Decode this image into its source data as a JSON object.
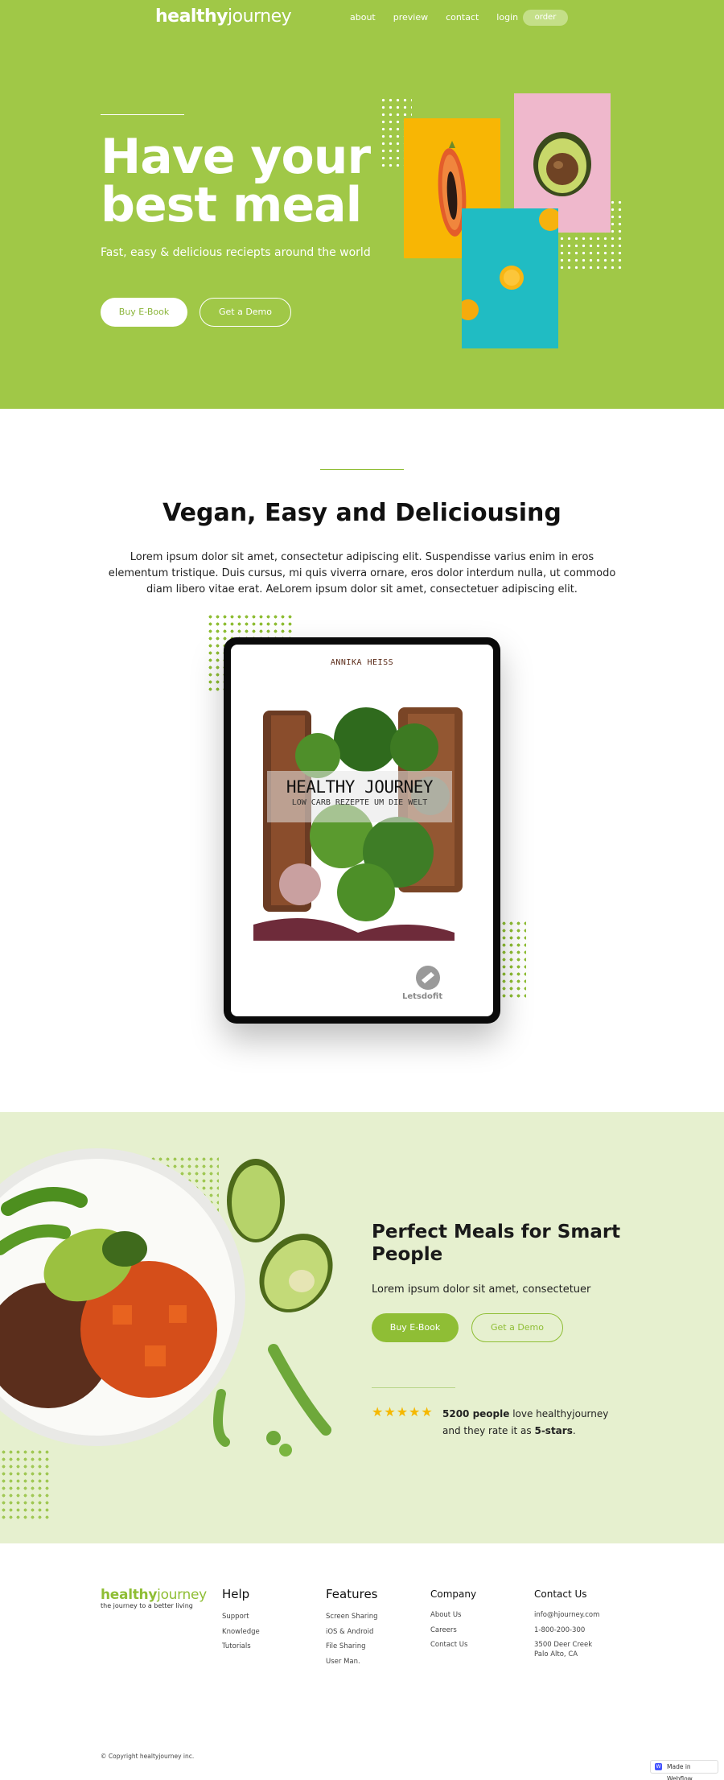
{
  "nav": {
    "logo_bold": "healthy",
    "logo_light": "journey",
    "links": [
      "about",
      "preview",
      "contact",
      "login"
    ],
    "order": "order"
  },
  "hero": {
    "title": "Have your best meal",
    "subtitle": "Fast, easy & delicious reciepts around the world",
    "btn_primary": "Buy E-Book",
    "btn_secondary": "Get a Demo"
  },
  "intro": {
    "title": "Vegan, Easy and Deliciousing",
    "body": "Lorem ipsum dolor sit amet, consectetur adipiscing elit. Suspendisse varius enim in eros elementum tristique. Duis cursus, mi quis viverra ornare, eros dolor interdum nulla, ut commodo diam libero vitae erat. AeLorem ipsum dolor sit amet, consectetuer adipiscing elit."
  },
  "book": {
    "author": "ANNIKA HEISS",
    "title": "HEALTHY JOURNEY",
    "subtitle": "LOW CARB REZEPTE UM DIE WELT",
    "publisher": "Letsdofit"
  },
  "feature": {
    "title": "Perfect Meals for Smart People",
    "text": "Lorem ipsum dolor sit amet, consectetuer",
    "btn_primary": "Buy E-Book",
    "btn_secondary": "Get a Demo",
    "stars": "★★★★★",
    "rating_count": "5200 people",
    "rating_mid": " love healthyjourney and they rate it as ",
    "rating_value": "5-stars",
    "rating_end": "."
  },
  "footer": {
    "logo_bold": "healthy",
    "logo_light": "journey",
    "tagline": "the journey to a better living",
    "help": {
      "title": "Help",
      "links": [
        "Support",
        "Knowledge",
        "Tutorials"
      ]
    },
    "features": {
      "title": "Features",
      "links": [
        "Screen Sharing",
        "iOS & Android",
        "File Sharing",
        "User Man."
      ]
    },
    "company": {
      "title": "Company",
      "links": [
        "About Us",
        "Careers",
        "Contact Us"
      ]
    },
    "contact": {
      "title": "Contact Us",
      "lines": [
        "info@hjourney.com",
        "1-800-200-300",
        "3500 Deer Creek",
        "Palo Alto, CA"
      ]
    },
    "copyright": "© Copyright healtyjourney inc.",
    "badge": "Made in Webflow"
  },
  "colors": {
    "brand_green": "#a0c847",
    "accent_green": "#8fbe35",
    "light_green_bg": "#e6f0cf",
    "star_yellow": "#f5b800"
  }
}
